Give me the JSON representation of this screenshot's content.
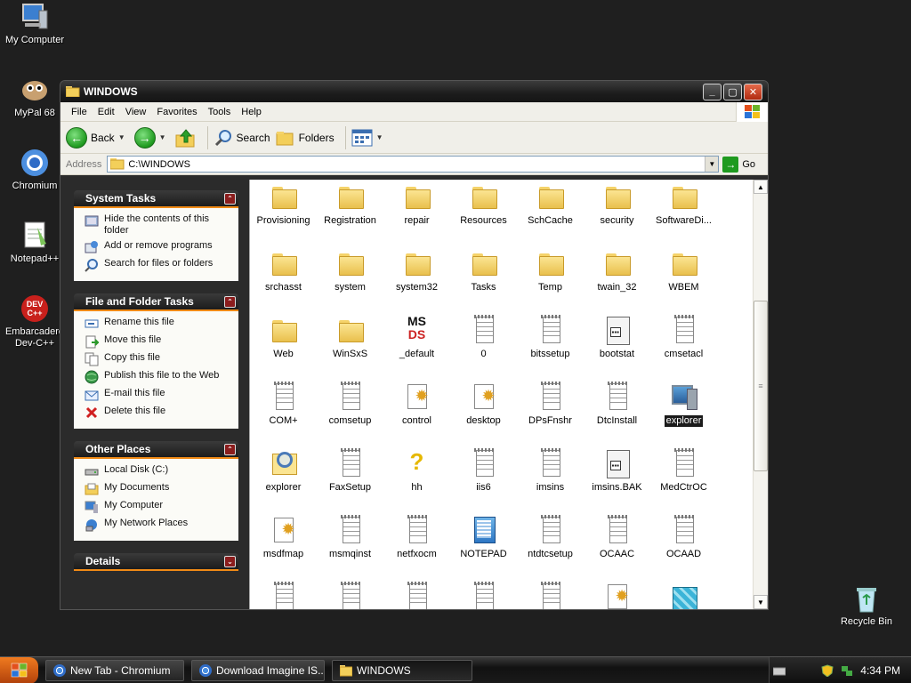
{
  "desktop": {
    "icons": [
      {
        "label": "My Computer"
      },
      {
        "label": "MyPal 68"
      },
      {
        "label": "Chromium"
      },
      {
        "label": "Notepad++"
      },
      {
        "label": "Embarcadero Dev-C++"
      },
      {
        "label": "Recycle Bin"
      }
    ]
  },
  "window": {
    "title": "WINDOWS",
    "menu": [
      "File",
      "Edit",
      "View",
      "Favorites",
      "Tools",
      "Help"
    ],
    "toolbar": {
      "back": "Back",
      "search": "Search",
      "folders": "Folders"
    },
    "address": {
      "label": "Address",
      "value": "C:\\WINDOWS",
      "go": "Go"
    }
  },
  "taskpane": {
    "system_tasks": {
      "title": "System Tasks",
      "items": [
        "Hide the contents of this folder",
        "Add or remove programs",
        "Search for files or folders"
      ]
    },
    "file_folder_tasks": {
      "title": "File and Folder Tasks",
      "items": [
        "Rename this file",
        "Move this file",
        "Copy this file",
        "Publish this file to the Web",
        "E-mail this file",
        "Delete this file"
      ]
    },
    "other_places": {
      "title": "Other Places",
      "items": [
        "Local Disk (C:)",
        "My Documents",
        "My Computer",
        "My Network Places"
      ]
    },
    "details": {
      "title": "Details"
    }
  },
  "files": [
    {
      "name": "Provisioning",
      "icon": "folder"
    },
    {
      "name": "Registration",
      "icon": "folder"
    },
    {
      "name": "repair",
      "icon": "folder"
    },
    {
      "name": "Resources",
      "icon": "folder"
    },
    {
      "name": "SchCache",
      "icon": "folder"
    },
    {
      "name": "security",
      "icon": "folder"
    },
    {
      "name": "SoftwareDi...",
      "icon": "folder"
    },
    {
      "name": "srchasst",
      "icon": "folder"
    },
    {
      "name": "system",
      "icon": "folder"
    },
    {
      "name": "system32",
      "icon": "folder"
    },
    {
      "name": "Tasks",
      "icon": "folder"
    },
    {
      "name": "Temp",
      "icon": "folder"
    },
    {
      "name": "twain_32",
      "icon": "folder"
    },
    {
      "name": "WBEM",
      "icon": "folder"
    },
    {
      "name": "Web",
      "icon": "folder"
    },
    {
      "name": "WinSxS",
      "icon": "folder"
    },
    {
      "name": "_default",
      "icon": "ms"
    },
    {
      "name": "0",
      "icon": "doc"
    },
    {
      "name": "bitssetup",
      "icon": "doc"
    },
    {
      "name": "bootstat",
      "icon": "app"
    },
    {
      "name": "cmsetacl",
      "icon": "doc"
    },
    {
      "name": "COM+",
      "icon": "doc"
    },
    {
      "name": "comsetup",
      "icon": "doc"
    },
    {
      "name": "control",
      "icon": "gear"
    },
    {
      "name": "desktop",
      "icon": "gear"
    },
    {
      "name": "DPsFnshr",
      "icon": "doc"
    },
    {
      "name": "DtcInstall",
      "icon": "doc"
    },
    {
      "name": "explorer",
      "icon": "pc",
      "selected": true
    },
    {
      "name": "explorer",
      "icon": "mag"
    },
    {
      "name": "FaxSetup",
      "icon": "doc"
    },
    {
      "name": "hh",
      "icon": "help"
    },
    {
      "name": "iis6",
      "icon": "doc"
    },
    {
      "name": "imsins",
      "icon": "doc"
    },
    {
      "name": "imsins.BAK",
      "icon": "app"
    },
    {
      "name": "MedCtrOC",
      "icon": "doc"
    },
    {
      "name": "msdfmap",
      "icon": "gear"
    },
    {
      "name": "msmqinst",
      "icon": "doc"
    },
    {
      "name": "netfxocm",
      "icon": "doc"
    },
    {
      "name": "NOTEPAD",
      "icon": "note"
    },
    {
      "name": "ntdtcsetup",
      "icon": "doc"
    },
    {
      "name": "OCAAC",
      "icon": "doc"
    },
    {
      "name": "OCAAD",
      "icon": "doc"
    },
    {
      "name": "",
      "icon": "doc"
    },
    {
      "name": "",
      "icon": "doc"
    },
    {
      "name": "",
      "icon": "doc"
    },
    {
      "name": "",
      "icon": "doc"
    },
    {
      "name": "",
      "icon": "doc"
    },
    {
      "name": "",
      "icon": "gear"
    },
    {
      "name": "",
      "icon": "cube"
    }
  ],
  "taskbar": {
    "buttons": [
      {
        "label": "New Tab - Chromium"
      },
      {
        "label": "Download Imagine IS..."
      },
      {
        "label": "WINDOWS"
      }
    ],
    "clock": "4:34 PM"
  }
}
